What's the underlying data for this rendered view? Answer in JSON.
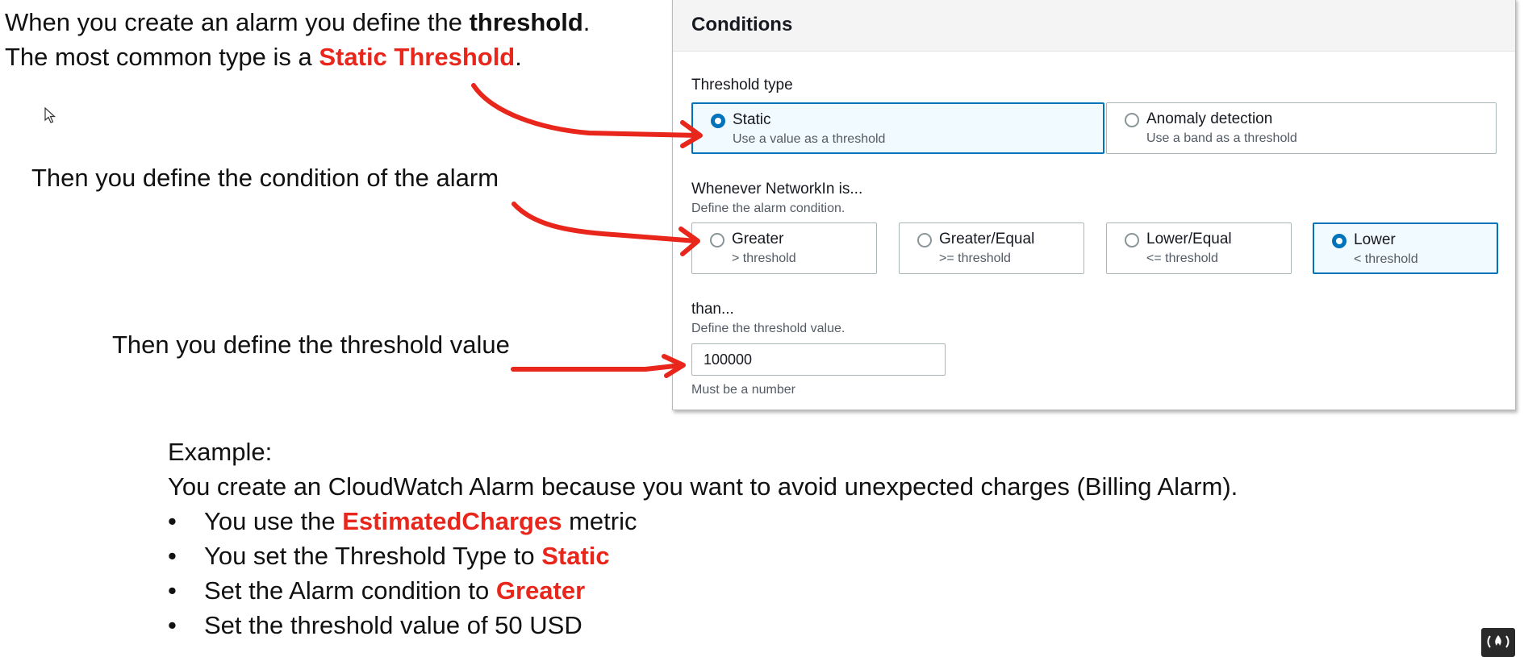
{
  "intro": {
    "line1_prefix": "When you create an alarm you define the ",
    "line1_bold": "threshold",
    "line1_suffix": ".",
    "line2_prefix": "The most common type is a ",
    "line2_highlight": "Static Threshold",
    "line2_suffix": "."
  },
  "notes": {
    "condition": "Then you define the condition of the alarm",
    "threshold_value": "Then you define the threshold value"
  },
  "conditions_panel": {
    "title": "Conditions",
    "threshold_type": {
      "label": "Threshold type",
      "options": [
        {
          "title": "Static",
          "desc": "Use a value as a threshold",
          "selected": true
        },
        {
          "title": "Anomaly detection",
          "desc": "Use a band as a threshold",
          "selected": false
        }
      ]
    },
    "whenever": {
      "label": "Whenever NetworkIn is...",
      "desc": "Define the alarm condition.",
      "options": [
        {
          "title": "Greater",
          "desc": "> threshold",
          "selected": false
        },
        {
          "title": "Greater/Equal",
          "desc": ">= threshold",
          "selected": false
        },
        {
          "title": "Lower/Equal",
          "desc": "<= threshold",
          "selected": false
        },
        {
          "title": "Lower",
          "desc": "< threshold",
          "selected": true
        }
      ]
    },
    "than": {
      "label": "than...",
      "desc": "Define the threshold value.",
      "value": "100000",
      "hint": "Must be a number"
    }
  },
  "example": {
    "heading": "Example:",
    "intro": "You create an CloudWatch Alarm because you want to avoid unexpected charges (Billing Alarm).",
    "bullets": [
      {
        "prefix": "You use the ",
        "highlight": "EstimatedCharges",
        "suffix": " metric"
      },
      {
        "prefix": "You set the Threshold Type to ",
        "highlight": "Static",
        "suffix": ""
      },
      {
        "prefix": "Set the Alarm condition to ",
        "highlight": "Greater",
        "suffix": ""
      },
      {
        "prefix": "Set the threshold value of 50 USD",
        "highlight": "",
        "suffix": ""
      }
    ]
  },
  "colors": {
    "annotation_red": "#e8261c",
    "selection_blue": "#0073bb"
  },
  "icons": {
    "cursor": "mouse-pointer-icon",
    "logo": "freecodecamp-logo-icon"
  }
}
